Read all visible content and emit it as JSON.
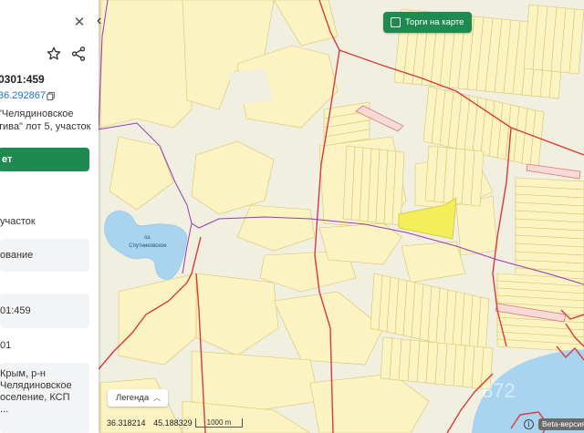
{
  "map": {
    "colors": {
      "background": "#f1efe0",
      "parcel_fill": "#fbf3c2",
      "parcel_stroke": "#d8c46a",
      "selected_fill": "#f3ee5a",
      "highlight_fill": "#f7d9d6",
      "boundary": "#d93a3a",
      "road": "#9a3ab3",
      "water": "#a8d4ef"
    },
    "lake_label": "оз. Спутниковское",
    "watermark": "872"
  },
  "panel": {
    "close_icon": "close-icon",
    "star_icon": "star-icon",
    "share_icon": "share-icon",
    "cadastral_number": "0301:459",
    "coordinates": "36.292867",
    "copy_icon": "copy-icon",
    "address_lines": [
      "\"Челядиновское",
      "тива\" лот 5, участок"
    ],
    "action_button": "ет",
    "field1": "участок",
    "field2": "ование",
    "field3": "01:459",
    "field4": "01",
    "field5_lines": [
      "Крым, р-н",
      "Челядиновское",
      "оселение, КСП",
      "..."
    ]
  },
  "controls": {
    "back_icon": "chevron-left-icon",
    "auction_label": "Торги на карте",
    "legend_label": "Легенда",
    "legend_chevron": "chevron-up-icon",
    "coord_lon": "36.318214",
    "coord_lat": "45.188329",
    "scale_label": "1000 m",
    "info_icon": "info-icon",
    "beta_label": "Beta-версия"
  }
}
